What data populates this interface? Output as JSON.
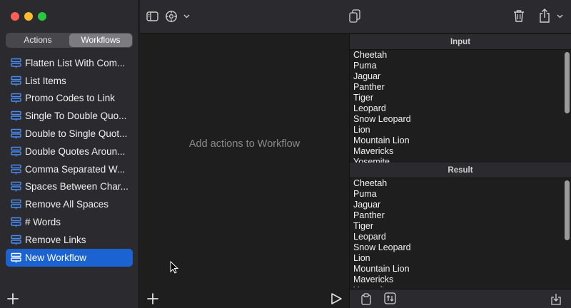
{
  "sidebar": {
    "segments": [
      "Actions",
      "Workflows"
    ],
    "selected_segment": "Workflows",
    "workflows": [
      "Flatten List With Com...",
      "List Items",
      "Promo Codes to Link",
      "Single To Double Quo...",
      "Double to Single Quot...",
      "Double Quotes Aroun...",
      "Comma Separated W...",
      "Spaces Between Char...",
      "Remove All Spaces",
      "# Words",
      "Remove Links",
      "New Workflow"
    ],
    "selected_workflow": "New Workflow"
  },
  "editor": {
    "placeholder": "Add actions to Workflow"
  },
  "input_pane": {
    "title": "Input",
    "lines": [
      "Cheetah",
      "Puma",
      "Jaguar",
      "Panther",
      "Tiger",
      "Leopard",
      "Snow Leopard",
      "Lion",
      "Mountain Lion",
      "Mavericks",
      "Yosemite"
    ]
  },
  "result_pane": {
    "title": "Result",
    "lines": [
      "Cheetah",
      "Puma",
      "Jaguar",
      "Panther",
      "Tiger",
      "Leopard",
      "Snow Leopard",
      "Lion",
      "Mountain Lion",
      "Mavericks",
      "Yosemite"
    ]
  },
  "colors": {
    "accent": "#1b63d3",
    "workflow_icon": "#4a8ef5"
  },
  "icons": [
    "sidebar-toggle-icon",
    "gear-icon",
    "chevron-down-icon",
    "copy-icon",
    "trash-icon",
    "share-icon",
    "plus-icon",
    "play-icon",
    "paste-icon",
    "swap-icon",
    "import-icon",
    "workflow-icon",
    "cursor-icon"
  ]
}
